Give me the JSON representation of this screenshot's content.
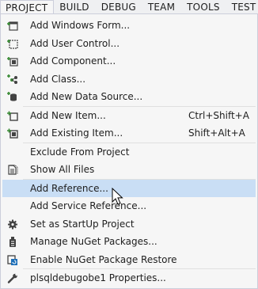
{
  "menubar": {
    "items": [
      {
        "label": "PROJECT",
        "active": true
      },
      {
        "label": "BUILD"
      },
      {
        "label": "DEBUG"
      },
      {
        "label": "TEAM"
      },
      {
        "label": "TOOLS"
      },
      {
        "label": "TEST"
      }
    ]
  },
  "menu": {
    "add_windows_form": "Add Windows Form...",
    "add_user_control": "Add User Control...",
    "add_component": "Add Component...",
    "add_class": "Add Class...",
    "add_new_data_source": "Add New Data Source...",
    "add_new_item": "Add New Item...",
    "add_new_item_shortcut": "Ctrl+Shift+A",
    "add_existing_item": "Add Existing Item...",
    "add_existing_item_shortcut": "Shift+Alt+A",
    "exclude_from_project": "Exclude From Project",
    "show_all_files": "Show All Files",
    "add_reference": "Add Reference...",
    "add_service_reference": "Add Service Reference...",
    "set_as_startup_project": "Set as StartUp Project",
    "manage_nuget_packages": "Manage NuGet Packages...",
    "enable_nuget_package_restore": "Enable NuGet Package Restore",
    "properties": "plsqldebugobe1 Properties..."
  },
  "colors": {
    "highlight": "#c9def5",
    "menu_background": "#f6f6f6",
    "border": "#cccedb"
  }
}
